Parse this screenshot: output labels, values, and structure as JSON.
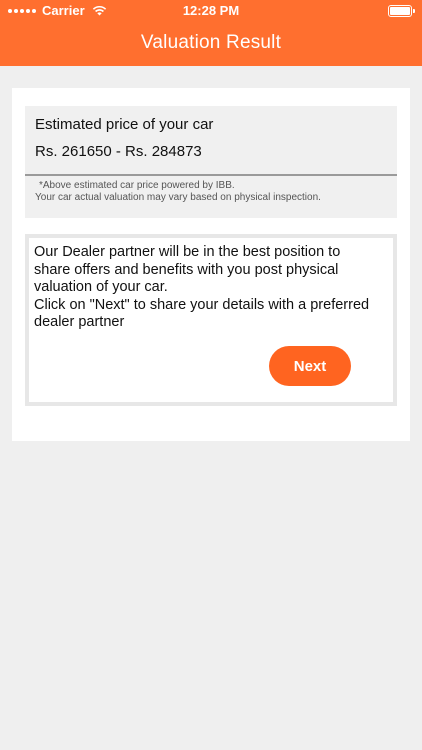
{
  "status_bar": {
    "carrier": "Carrier",
    "time": "12:28 PM"
  },
  "header": {
    "title": "Valuation Result"
  },
  "price_box": {
    "label": "Estimated price of your car",
    "value": "Rs. 261650 - Rs. 284873",
    "note_line1": "*Above estimated car price powered by IBB.",
    "note_line2": "Your car actual valuation may vary based on physical inspection."
  },
  "info_box": {
    "line1": "Our Dealer partner will be in the best position to",
    "line2": "share offers and benefits with you post physical",
    "line3": "valuation of your car.",
    "line4": "Click on \"Next\" to share your details with a preferred",
    "line5": "dealer partner",
    "next_label": "Next"
  },
  "colors": {
    "accent": "#ff6f2f",
    "button": "#ff6420",
    "background": "#efefef"
  }
}
